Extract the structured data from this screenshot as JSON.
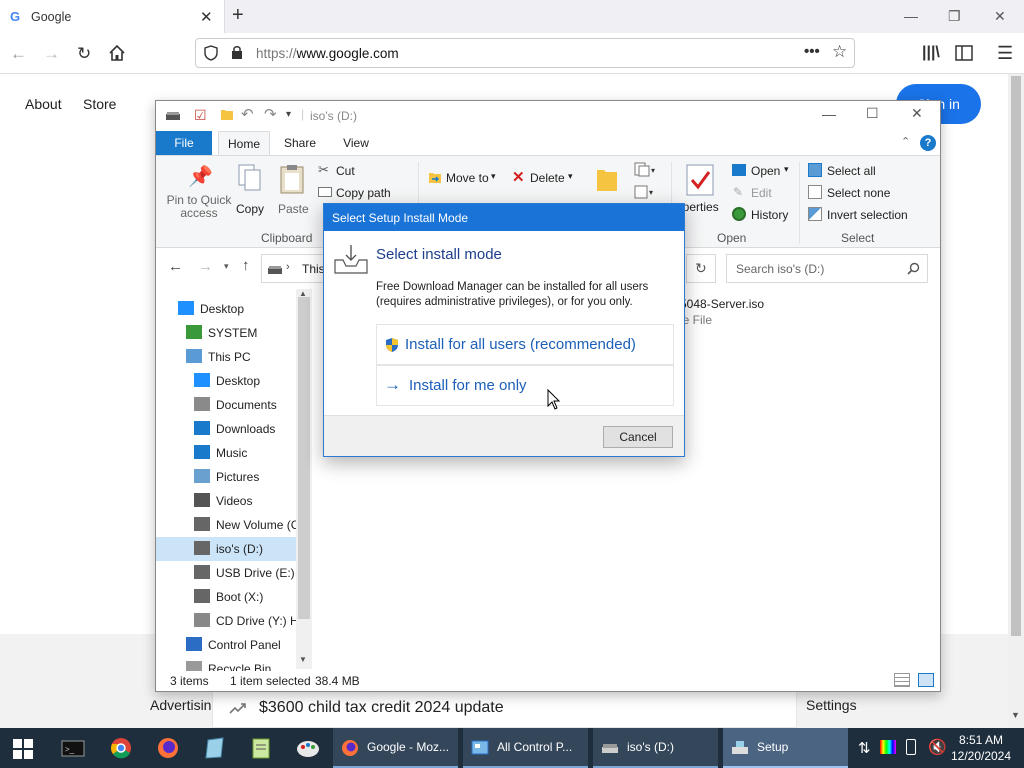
{
  "browser": {
    "tab_title": "Google",
    "url_scheme": "https://",
    "url_host": "www.google.com"
  },
  "google": {
    "about": "About",
    "store": "Store",
    "signin": "Sign in",
    "trending": "$3600 child tax credit 2024 update",
    "advertising": "Advertisin",
    "settings": "Settings"
  },
  "explorer": {
    "title": "iso's (D:)",
    "tabs": {
      "file": "File",
      "home": "Home",
      "share": "Share",
      "view": "View"
    },
    "ribbon": {
      "pin": "Pin to Quick access",
      "copy": "Copy",
      "paste": "Paste",
      "cut": "Cut",
      "copy_path": "Copy path",
      "clipboard": "Clipboard",
      "move_to": "Move to",
      "delete": "Delete",
      "properties": "operties",
      "open_menu": "Open",
      "edit": "Edit",
      "history": "History",
      "open_group": "Open",
      "select_all": "Select all",
      "select_none": "Select none",
      "invert": "Invert selection",
      "select_group": "Select"
    },
    "address_crumb": "This",
    "search_placeholder": "Search iso's (D:)",
    "file_name": "-5048-Server.iso",
    "file_type": "ge File",
    "tree": [
      {
        "label": "Desktop",
        "icon": "desktop-icon"
      },
      {
        "label": "SYSTEM",
        "icon": "user-icon"
      },
      {
        "label": "This PC",
        "icon": "computer-icon"
      },
      {
        "label": "Desktop",
        "icon": "desktop-icon"
      },
      {
        "label": "Documents",
        "icon": "documents-icon"
      },
      {
        "label": "Downloads",
        "icon": "downloads-icon"
      },
      {
        "label": "Music",
        "icon": "music-icon"
      },
      {
        "label": "Pictures",
        "icon": "pictures-icon"
      },
      {
        "label": "Videos",
        "icon": "videos-icon"
      },
      {
        "label": "New Volume (C",
        "icon": "drive-icon"
      },
      {
        "label": "iso's (D:)",
        "icon": "drive-icon"
      },
      {
        "label": "USB Drive (E:)",
        "icon": "drive-icon"
      },
      {
        "label": "Boot (X:)",
        "icon": "drive-icon"
      },
      {
        "label": "CD Drive (Y:) H",
        "icon": "cd-drive-icon"
      },
      {
        "label": "Control Panel",
        "icon": "control-panel-icon"
      },
      {
        "label": "Recycle Bin",
        "icon": "recycle-bin-icon"
      }
    ],
    "status": {
      "items": "3 items",
      "selected": "1 item selected",
      "size": "38.4 MB"
    }
  },
  "dialog": {
    "title": "Select Setup Install Mode",
    "heading": "Select install mode",
    "description": "Free Download Manager can be installed for all users (requires administrative privileges), or for you only.",
    "option_all": "Install for all users (recommended)",
    "option_me": "Install for me only",
    "cancel": "Cancel"
  },
  "taskbar": {
    "buttons": [
      {
        "label": "Google - Moz...",
        "icon": "firefox-icon"
      },
      {
        "label": "All Control P...",
        "icon": "control-panel-icon"
      },
      {
        "label": "iso's (D:)",
        "icon": "drive-icon"
      },
      {
        "label": "Setup",
        "icon": "setup-icon"
      }
    ],
    "time": "8:51 AM",
    "date": "12/20/2024"
  }
}
